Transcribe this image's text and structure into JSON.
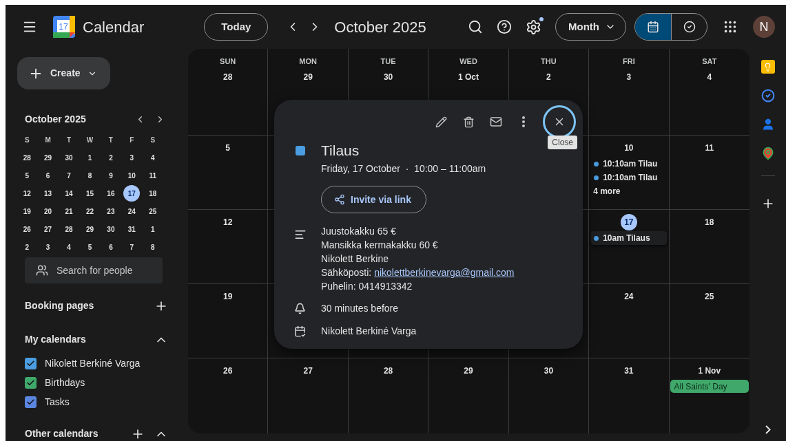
{
  "header": {
    "logo_text": "17",
    "app_name": "Calendar",
    "today_button": "Today",
    "period": "October 2025",
    "settings_badge": true,
    "view_dropdown": "Month",
    "view_toggle": [
      {
        "kind": "calendar",
        "selected": true
      },
      {
        "kind": "tasks",
        "selected": false
      }
    ],
    "avatar": "N"
  },
  "sidebar": {
    "create_button": "Create",
    "mini_calendar": {
      "title": "October 2025",
      "weekdays": [
        "S",
        "M",
        "T",
        "W",
        "T",
        "F",
        "S"
      ],
      "weeks": [
        [
          {
            "d": "28",
            "selected": false
          },
          {
            "d": "29",
            "selected": false
          },
          {
            "d": "30",
            "selected": false
          },
          {
            "d": "1",
            "selected": false
          },
          {
            "d": "2",
            "selected": false
          },
          {
            "d": "3",
            "selected": false
          },
          {
            "d": "4",
            "selected": false
          }
        ],
        [
          {
            "d": "5",
            "selected": false
          },
          {
            "d": "6",
            "selected": false
          },
          {
            "d": "7",
            "selected": false
          },
          {
            "d": "8",
            "selected": false
          },
          {
            "d": "9",
            "selected": false
          },
          {
            "d": "10",
            "selected": false
          },
          {
            "d": "11",
            "selected": false
          }
        ],
        [
          {
            "d": "12",
            "selected": false
          },
          {
            "d": "13",
            "selected": false
          },
          {
            "d": "14",
            "selected": false
          },
          {
            "d": "15",
            "selected": false
          },
          {
            "d": "16",
            "selected": false
          },
          {
            "d": "17",
            "selected": true
          },
          {
            "d": "18",
            "selected": false
          }
        ],
        [
          {
            "d": "19",
            "selected": false
          },
          {
            "d": "20",
            "selected": false
          },
          {
            "d": "21",
            "selected": false
          },
          {
            "d": "22",
            "selected": false
          },
          {
            "d": "23",
            "selected": false
          },
          {
            "d": "24",
            "selected": false
          },
          {
            "d": "25",
            "selected": false
          }
        ],
        [
          {
            "d": "26",
            "selected": false
          },
          {
            "d": "27",
            "selected": false
          },
          {
            "d": "28",
            "selected": false
          },
          {
            "d": "29",
            "selected": false
          },
          {
            "d": "30",
            "selected": false
          },
          {
            "d": "31",
            "selected": false
          },
          {
            "d": "1",
            "selected": false
          }
        ],
        [
          {
            "d": "2",
            "selected": false
          },
          {
            "d": "3",
            "selected": false
          },
          {
            "d": "4",
            "selected": false
          },
          {
            "d": "5",
            "selected": false
          },
          {
            "d": "6",
            "selected": false
          },
          {
            "d": "7",
            "selected": false
          },
          {
            "d": "8",
            "selected": false
          }
        ]
      ]
    },
    "search_people": {
      "placeholder": "Search for people"
    },
    "booking_pages": "Booking pages",
    "my_calendars": {
      "title": "My calendars",
      "expanded": true,
      "items": [
        {
          "label": "Nikolett Berkiné Varga",
          "checked": true,
          "color": "#4a9de0"
        },
        {
          "label": "Birthdays",
          "checked": true,
          "color": "#3fa86a"
        },
        {
          "label": "Tasks",
          "checked": true,
          "color": "#5a86e0"
        }
      ]
    },
    "other_calendars": {
      "title": "Other calendars",
      "expanded": true
    }
  },
  "month_grid": {
    "weeks": [
      [
        {
          "weekday": "SUN",
          "date": "28",
          "today": false
        },
        {
          "weekday": "MON",
          "date": "29",
          "today": false
        },
        {
          "weekday": "TUE",
          "date": "30",
          "today": false
        },
        {
          "weekday": "WED",
          "date": "1 Oct",
          "today": false
        },
        {
          "weekday": "THU",
          "date": "2",
          "today": false
        },
        {
          "weekday": "FRI",
          "date": "3",
          "today": false
        },
        {
          "weekday": "SAT",
          "date": "4",
          "today": false
        }
      ],
      {
        "before_popup": [
          {
            "date": "5",
            "today": false
          }
        ],
        "after_popup": [
          {
            "date": "10",
            "today": false,
            "events": [
              {
                "kind": "timed",
                "text": "10:10am Tilau",
                "selected": false,
                "color": "#4a9de0"
              },
              {
                "kind": "timed",
                "text": "10:10am Tilau",
                "selected": false,
                "color": "#4a9de0"
              },
              {
                "kind": "more",
                "text": "4 more"
              }
            ]
          },
          {
            "date": "11",
            "today": false
          }
        ]
      },
      {
        "before_popup": [
          {
            "date": "12",
            "today": false
          }
        ],
        "after_popup": [
          {
            "date": "17",
            "today": true,
            "events": [
              {
                "kind": "timed",
                "text": "10am Tilaus",
                "selected": true,
                "color": "#4a9de0"
              }
            ]
          },
          {
            "date": "18",
            "today": false
          }
        ]
      },
      {
        "before_popup": [
          {
            "date": "19",
            "today": false
          }
        ],
        "after_popup": [
          {
            "date": "24",
            "today": false
          },
          {
            "date": "25",
            "today": false
          }
        ]
      },
      [
        {
          "date": "26",
          "today": false
        },
        {
          "date": "27",
          "today": false
        },
        {
          "date": "28",
          "today": false
        },
        {
          "date": "29",
          "today": false
        },
        {
          "date": "30",
          "today": false
        },
        {
          "date": "31",
          "today": false
        },
        {
          "date": "1 Nov",
          "today": false,
          "events": [
            {
              "kind": "allday",
              "text": "All Saints' Day",
              "selected": false,
              "color": "#3fa86a"
            }
          ]
        }
      ]
    ]
  },
  "event_popup": {
    "title": "Tilaus",
    "color": "#4a9de0",
    "when": "Friday, 17 October  ·  10:00 – 11:00am",
    "tooltip": "Close",
    "invite_button": "Invite via link",
    "description": [
      {
        "kind": "text",
        "text": "Juustokakku 65 €"
      },
      {
        "kind": "text",
        "text": "Mansikka kermakakku 60 €"
      },
      {
        "kind": "text",
        "text": "Nikolett Berkine"
      },
      {
        "kind": "link",
        "label": "Sähköposti:",
        "text": "nikolettberkinevarga@gmail.com"
      },
      {
        "kind": "text",
        "text": "Puhelin: 0414913342"
      }
    ],
    "reminder": "30 minutes before",
    "calendar": "Nikolett Berkiné Varga"
  }
}
